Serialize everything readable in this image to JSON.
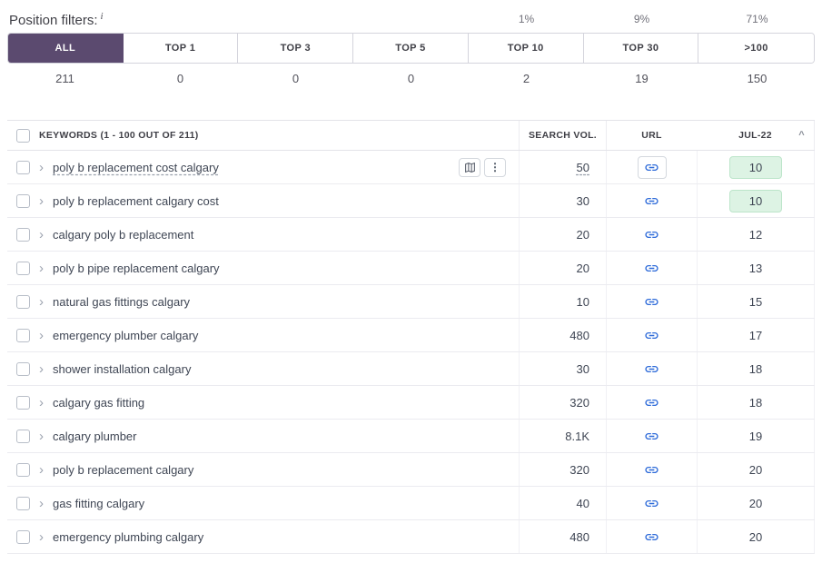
{
  "colors": {
    "accent_purple": "#5b4a6f",
    "link_blue": "#2e6bd9",
    "highlight_green_bg": "#ddf3e4",
    "highlight_green_border": "#bce5ca"
  },
  "position_filters": {
    "label": "Position filters:",
    "info_icon": "i",
    "tabs": [
      {
        "label": "ALL",
        "percent": "",
        "count": "211",
        "selected": true
      },
      {
        "label": "TOP 1",
        "percent": "",
        "count": "0",
        "selected": false
      },
      {
        "label": "TOP 3",
        "percent": "",
        "count": "0",
        "selected": false
      },
      {
        "label": "TOP 5",
        "percent": "",
        "count": "0",
        "selected": false
      },
      {
        "label": "TOP 10",
        "percent": "1%",
        "count": "2",
        "selected": false
      },
      {
        "label": "TOP 30",
        "percent": "9%",
        "count": "19",
        "selected": false
      },
      {
        "label": ">100",
        "percent": "71%",
        "count": "150",
        "selected": false
      }
    ]
  },
  "table": {
    "header": {
      "keywords": "KEYWORDS (1 - 100 OUT OF 211)",
      "search_vol": "SEARCH VOL.",
      "url": "URL",
      "position_col": "JUL-22",
      "sort_icon": "^"
    },
    "rows": [
      {
        "keyword": "poly b replacement cost calgary",
        "search_vol": "50",
        "position": "10",
        "highlight": true,
        "active": true
      },
      {
        "keyword": "poly b replacement calgary cost",
        "search_vol": "30",
        "position": "10",
        "highlight": true,
        "active": false
      },
      {
        "keyword": "calgary poly b replacement",
        "search_vol": "20",
        "position": "12",
        "highlight": false,
        "active": false
      },
      {
        "keyword": "poly b pipe replacement calgary",
        "search_vol": "20",
        "position": "13",
        "highlight": false,
        "active": false
      },
      {
        "keyword": "natural gas fittings calgary",
        "search_vol": "10",
        "position": "15",
        "highlight": false,
        "active": false
      },
      {
        "keyword": "emergency plumber calgary",
        "search_vol": "480",
        "position": "17",
        "highlight": false,
        "active": false
      },
      {
        "keyword": "shower installation calgary",
        "search_vol": "30",
        "position": "18",
        "highlight": false,
        "active": false
      },
      {
        "keyword": "calgary gas fitting",
        "search_vol": "320",
        "position": "18",
        "highlight": false,
        "active": false
      },
      {
        "keyword": "calgary plumber",
        "search_vol": "8.1K",
        "position": "19",
        "highlight": false,
        "active": false
      },
      {
        "keyword": "poly b replacement calgary",
        "search_vol": "320",
        "position": "20",
        "highlight": false,
        "active": false
      },
      {
        "keyword": "gas fitting calgary",
        "search_vol": "40",
        "position": "20",
        "highlight": false,
        "active": false
      },
      {
        "keyword": "emergency plumbing calgary",
        "search_vol": "480",
        "position": "20",
        "highlight": false,
        "active": false
      }
    ]
  }
}
